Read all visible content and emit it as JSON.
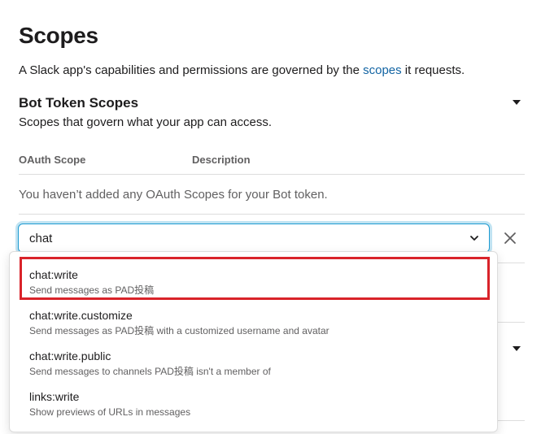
{
  "page": {
    "title": "Scopes",
    "intro_before": "A Slack app's capabilities and permissions are governed by the ",
    "intro_link": "scopes",
    "intro_after": " it requests."
  },
  "bot_scopes": {
    "title": "Bot Token Scopes",
    "subtitle": "Scopes that govern what your app can access.",
    "columns": [
      "OAuth Scope",
      "Description"
    ],
    "empty_message": "You haven’t added any OAuth Scopes for your Bot token."
  },
  "combobox": {
    "value": "chat",
    "chevron_icon": "chevron-down-icon",
    "close_icon": "close-icon"
  },
  "options": [
    {
      "name": "chat:write",
      "description": "Send messages as PAD投稿",
      "highlighted": true
    },
    {
      "name": "chat:write.customize",
      "description": "Send messages as PAD投稿 with a customized username and avatar",
      "highlighted": false
    },
    {
      "name": "chat:write.public",
      "description": "Send messages to channels PAD投稿 isn't a member of",
      "highlighted": false
    },
    {
      "name": "links:write",
      "description": "Show previews of URLs in messages",
      "highlighted": false
    }
  ],
  "colors": {
    "link": "#1264a3",
    "focus_ring": "#1d9bd1",
    "highlight_border": "#d9232a",
    "muted_text": "#616061"
  }
}
